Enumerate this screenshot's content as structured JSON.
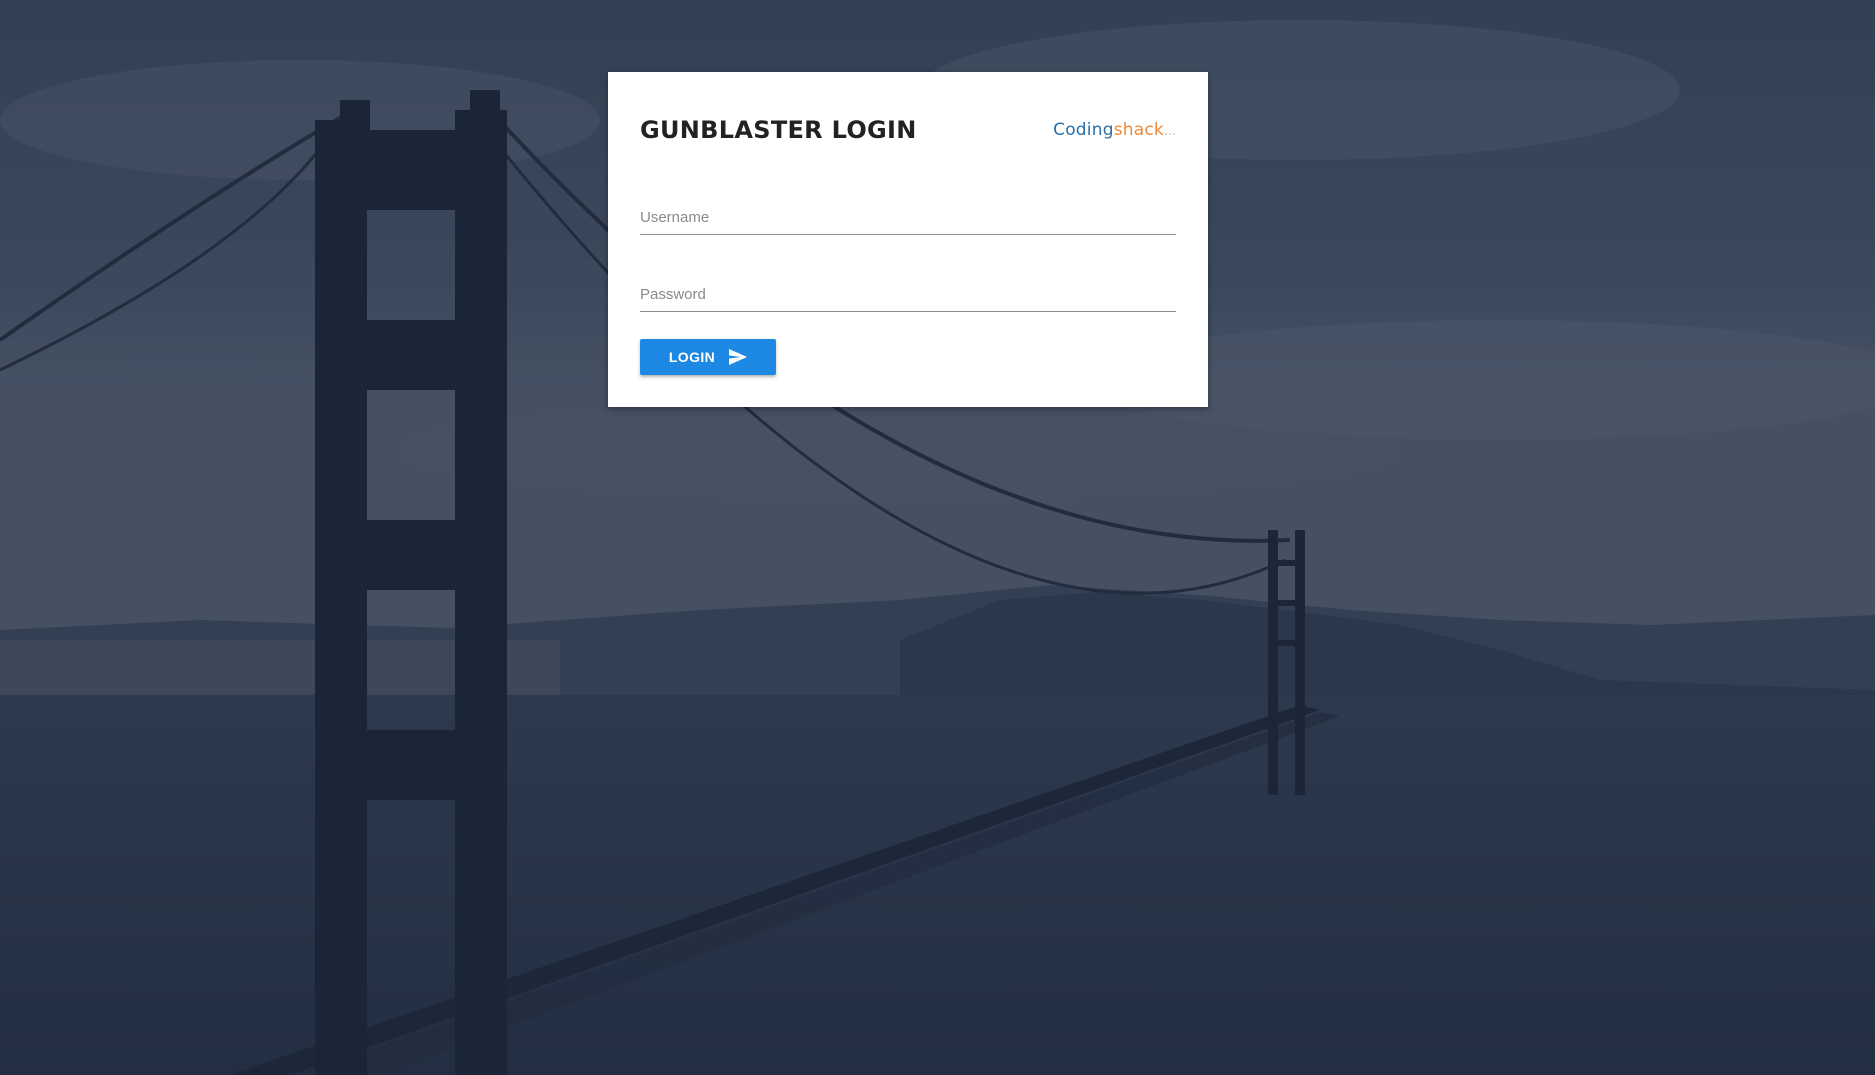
{
  "page": {
    "title": "GUNBLASTER LOGIN"
  },
  "brand": {
    "part1": "Coding",
    "part2": "shack",
    "suffix": "...",
    "color1": "#2a6fa8",
    "color2": "#ec8a3a"
  },
  "form": {
    "username_placeholder": "Username",
    "username_value": "",
    "password_placeholder": "Password",
    "password_value": "",
    "login_label": "LOGIN",
    "login_icon": "send-icon"
  },
  "colors": {
    "accent": "#1e88e5",
    "background_overlay": "#18263e"
  }
}
